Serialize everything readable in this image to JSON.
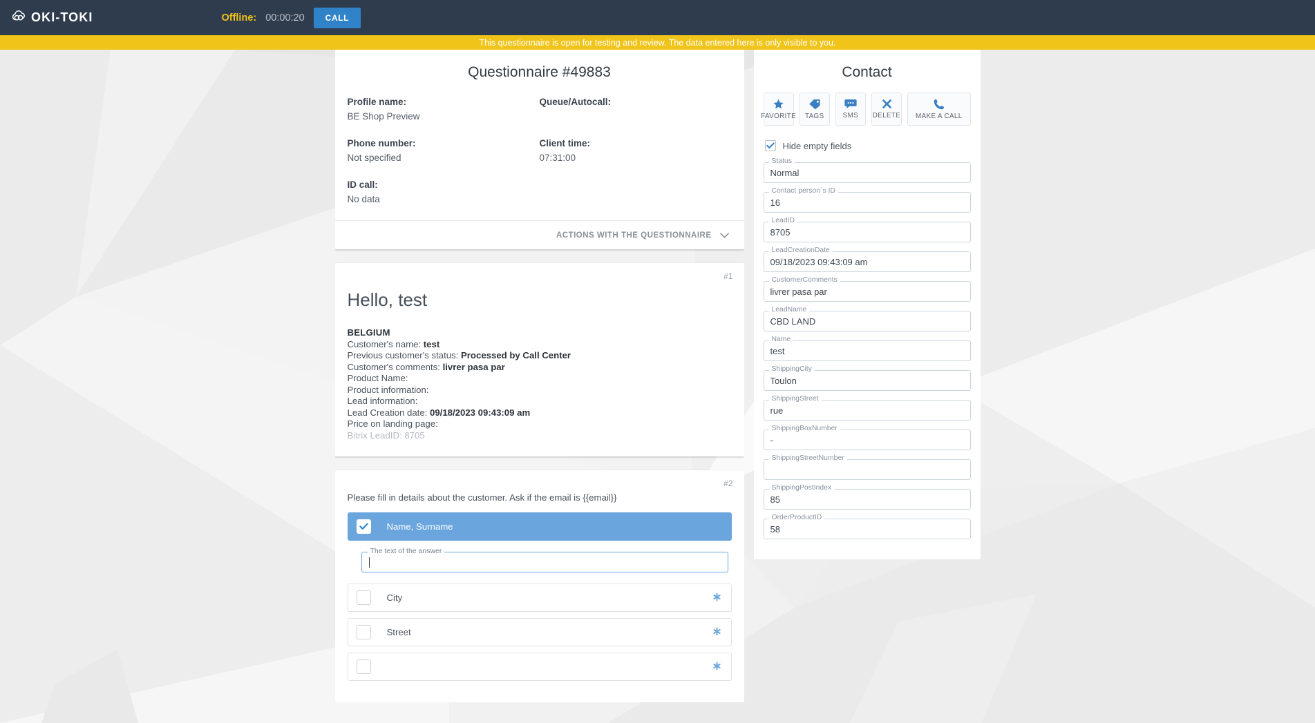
{
  "topbar": {
    "brand": "OKI-TOKI",
    "logo_icon": "cloud-logo-icon",
    "status_label": "Offline:",
    "status_timer": "00:00:20",
    "call_button": "CALL"
  },
  "notice": {
    "text": "This questionnaire is open for testing and review. The data entered here is only visible to you."
  },
  "questionnaire": {
    "title": "Questionnaire #49883",
    "meta": [
      {
        "label": "Profile name:",
        "value": "BE Shop Preview"
      },
      {
        "label": "Queue/Autocall:",
        "value": ""
      },
      {
        "label": "Phone number:",
        "value": "Not specified"
      },
      {
        "label": "Client time:",
        "value": "07:31:00"
      },
      {
        "label": "ID call:",
        "value": "No data"
      }
    ],
    "actions_label": "ACTIONS WITH THE QUESTIONNAIRE",
    "actions_chevron": "chevron-down-icon"
  },
  "greeting_card": {
    "index": "#1",
    "heading": "Hello, test",
    "lines": [
      {
        "text": "BELGIUM",
        "style": "country"
      },
      {
        "label": "Customer's name: ",
        "value": "test"
      },
      {
        "label": "Previous customer's status: ",
        "value": "Processed by Call Center"
      },
      {
        "label": "Customer's comments: ",
        "value": "livrer pasa par"
      },
      {
        "label": "Product Name:",
        "value": ""
      },
      {
        "label": "Product information:",
        "value": ""
      },
      {
        "label": "Lead information:",
        "value": ""
      },
      {
        "label": "Lead Creation date: ",
        "value": "09/18/2023 09:43:09 am"
      },
      {
        "label": "Price on landing page:",
        "value": ""
      },
      {
        "text": "Bitrix LeadID: 8705",
        "style": "muted"
      }
    ]
  },
  "question_card": {
    "index": "#2",
    "prompt": "Please fill in details about the customer. Ask if the email is {{email}}",
    "options": [
      {
        "label": "Name, Surname",
        "selected": true,
        "asterisk": false
      },
      {
        "label": "City",
        "selected": false,
        "asterisk": true
      },
      {
        "label": "Street",
        "selected": false,
        "asterisk": true
      },
      {
        "label": "",
        "selected": false,
        "asterisk": true
      }
    ],
    "answer_field": {
      "legend": "The text of the answer",
      "value": ""
    }
  },
  "contact": {
    "title": "Contact",
    "actions": [
      {
        "label": "FAVORITE",
        "icon": "star-icon",
        "wide": false
      },
      {
        "label": "TAGS",
        "icon": "tag-icon",
        "wide": false
      },
      {
        "label": "SMS",
        "icon": "sms-icon",
        "wide": false
      },
      {
        "label": "DELETE",
        "icon": "close-icon",
        "wide": false
      },
      {
        "label": "MAKE A CALL",
        "icon": "phone-icon",
        "wide": true
      }
    ],
    "hide_empty": {
      "label": "Hide empty fields",
      "checked": true
    },
    "fields": [
      {
        "legend": "Status",
        "value": "Normal"
      },
      {
        "legend": "Contact person`s ID",
        "value": "16"
      },
      {
        "legend": "LeadID",
        "value": "8705"
      },
      {
        "legend": "LeadCreationDate",
        "value": "09/18/2023 09:43:09 am"
      },
      {
        "legend": "CustomerComments",
        "value": "livrer pasa par"
      },
      {
        "legend": "LeadName",
        "value": "CBD LAND"
      },
      {
        "legend": "Name",
        "value": "test"
      },
      {
        "legend": "ShippingCity",
        "value": "Toulon"
      },
      {
        "legend": "ShippingStreet",
        "value": "rue"
      },
      {
        "legend": "ShippingBoxNumber",
        "value": "-"
      },
      {
        "legend": "ShippingStreetNumber",
        "value": ""
      },
      {
        "legend": "ShippingPostIndex",
        "value": "85"
      },
      {
        "legend": "OrderProductID",
        "value": "58"
      }
    ]
  },
  "colors": {
    "topbar": "#2f3c4e",
    "accent_yellow": "#f0c419",
    "accent_blue": "#3083c9",
    "selected_blue": "#6aa5de",
    "background": "#ededee"
  }
}
